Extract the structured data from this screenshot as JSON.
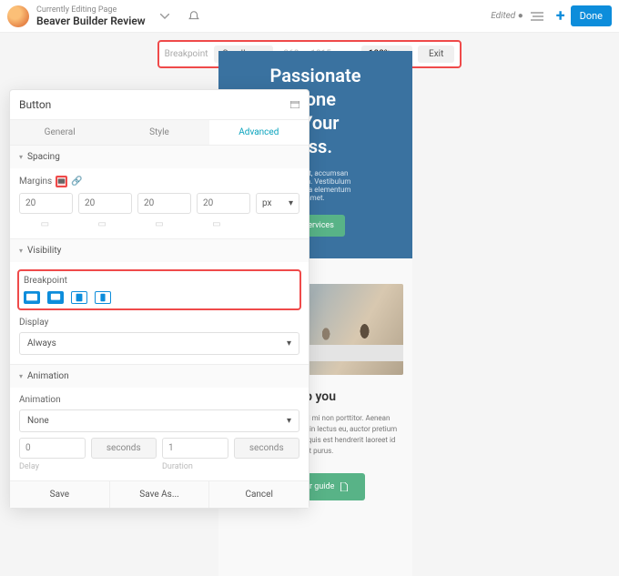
{
  "topbar": {
    "subtitle": "Currently Editing Page",
    "title": "Beaver Builder Review",
    "edited": "Edited",
    "done": "Done"
  },
  "toolbar": {
    "breakpoint_label": "Breakpoint",
    "breakpoint_value": "Small",
    "width": "360",
    "height": "1015",
    "dim_sep": "x",
    "unit": "px",
    "zoom": "100%",
    "exit": "Exit"
  },
  "preview": {
    "hero_title": "Passionate\n    t one\n. Your\n    ess.",
    "hero_text": "    arcu erat, accumsan\n      or at sem. Vestibulum\n   n vehicula elementum\n  amet.",
    "hero_cta": "ir services",
    "section_title": "elp you",
    "section_text": "Quisque commodo id mi non porttitor. Aenean sapien eros, commodo in lectus eu, auctor pretium diam. Mauris non orci quis est hendrerit laoreet id eget purus.",
    "section_cta": "Get your guide"
  },
  "panel": {
    "title": "Button",
    "tabs": [
      "General",
      "Style",
      "Advanced"
    ],
    "active_tab": 2,
    "spacing": {
      "header": "Spacing",
      "label": "Margins",
      "values": [
        "20",
        "20",
        "20",
        "20"
      ],
      "unit": "px"
    },
    "visibility": {
      "header": "Visibility",
      "breakpoint_label": "Breakpoint",
      "display_label": "Display",
      "display_value": "Always"
    },
    "animation": {
      "header": "Animation",
      "label": "Animation",
      "value": "None",
      "delay_value": "0",
      "delay_unit": "seconds",
      "duration_value": "1",
      "duration_unit": "seconds",
      "col1": "Delay",
      "col2": "Duration"
    },
    "actions": {
      "save": "Save",
      "saveas": "Save As...",
      "cancel": "Cancel"
    }
  }
}
